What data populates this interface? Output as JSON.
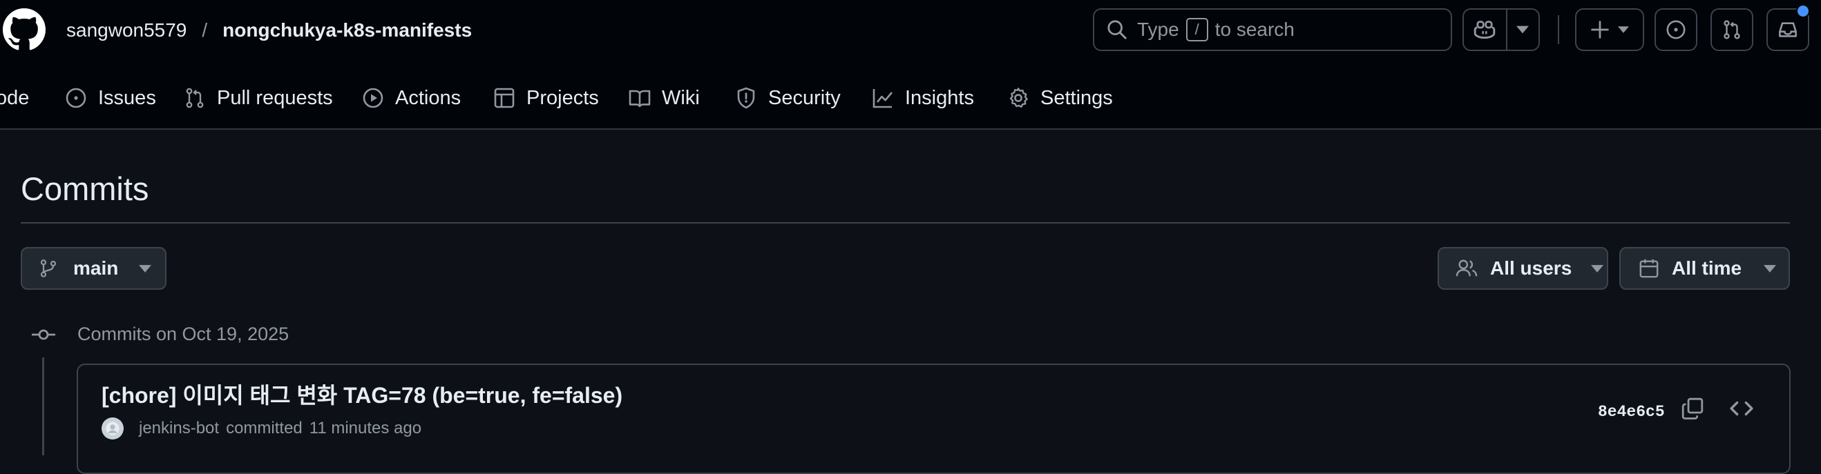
{
  "header": {
    "owner": "sangwon5579",
    "separator": "/",
    "repo": "nongchukya-k8s-manifests",
    "search": {
      "prefix": "Type",
      "key": "/",
      "suffix": "to search"
    }
  },
  "nav": {
    "items": [
      {
        "label": "ode",
        "icon": "code-icon"
      },
      {
        "label": "Issues",
        "icon": "issue-icon"
      },
      {
        "label": "Pull requests",
        "icon": "pull-request-icon"
      },
      {
        "label": "Actions",
        "icon": "play-icon"
      },
      {
        "label": "Projects",
        "icon": "table-icon"
      },
      {
        "label": "Wiki",
        "icon": "book-icon"
      },
      {
        "label": "Security",
        "icon": "shield-icon"
      },
      {
        "label": "Insights",
        "icon": "graph-icon"
      },
      {
        "label": "Settings",
        "icon": "gear-icon"
      }
    ]
  },
  "page": {
    "title": "Commits",
    "branch": "main",
    "filters": {
      "users": "All users",
      "time": "All time"
    }
  },
  "commit_group": {
    "heading": "Commits on Oct 19, 2025",
    "commits": [
      {
        "message": "[chore] 이미지 태그 변화 TAG=78 (be=true, fe=false)",
        "author": "jenkins-bot",
        "action": "committed",
        "time": "11 minutes ago",
        "sha": "8e4e6c5"
      }
    ]
  },
  "colors": {
    "header_bg": "#010409",
    "page_bg": "#0d1117",
    "border": "#3d444d",
    "muted": "#9198a1",
    "notification_dot": "#4493f8"
  }
}
